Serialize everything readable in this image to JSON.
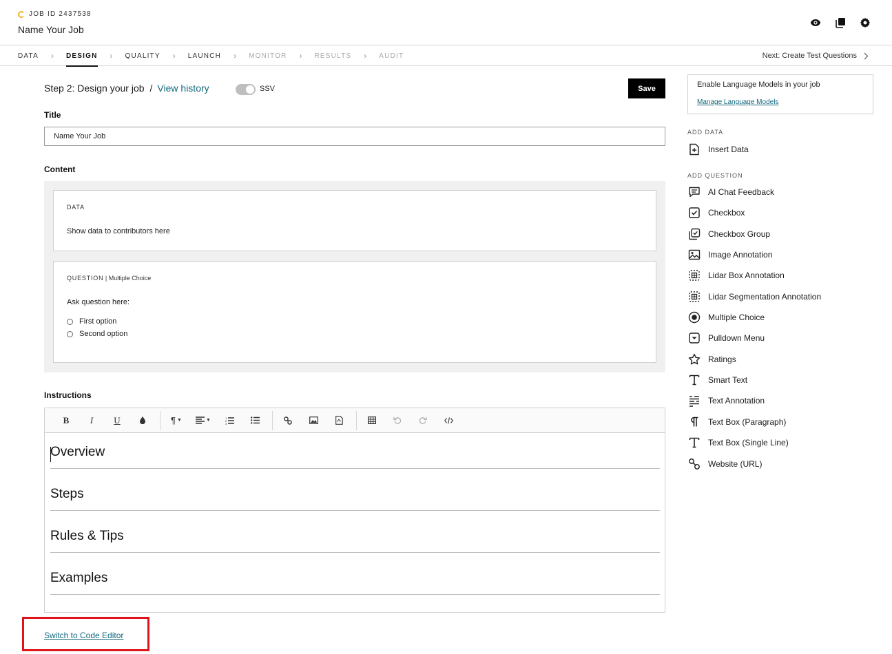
{
  "header": {
    "job_id": "JOB ID 2437538",
    "job_name": "Name Your Job"
  },
  "nav": {
    "steps": [
      {
        "label": "DATA",
        "state": "normal"
      },
      {
        "label": "DESIGN",
        "state": "active"
      },
      {
        "label": "QUALITY",
        "state": "normal"
      },
      {
        "label": "LAUNCH",
        "state": "normal"
      },
      {
        "label": "MONITOR",
        "state": "disabled"
      },
      {
        "label": "RESULTS",
        "state": "disabled"
      },
      {
        "label": "AUDIT",
        "state": "disabled"
      }
    ],
    "next_label": "Next: Create Test Questions"
  },
  "main": {
    "step_title": "Step 2: Design your job",
    "slash": "/",
    "view_history": "View history",
    "ssv_label": "SSV",
    "save_label": "Save",
    "title_label": "Title",
    "title_value": "Name Your Job",
    "content_label": "Content",
    "data_card": {
      "kicker": "DATA",
      "text": "Show data to contributors here"
    },
    "question_card": {
      "kicker": "QUESTION",
      "kicker_sub": " | Multiple Choice",
      "prompt": "Ask question here:",
      "options": [
        "First option",
        "Second option"
      ]
    },
    "instructions_label": "Instructions",
    "editor_headings": [
      "Overview",
      "Steps",
      "Rules & Tips",
      "Examples"
    ],
    "code_editor_link": "Switch to Code Editor"
  },
  "sidebar": {
    "lm_title": "Enable Language Models in your job",
    "lm_link": "Manage Language Models",
    "add_data_heading": "ADD DATA",
    "insert_data": "Insert Data",
    "add_question_heading": "ADD QUESTION",
    "questions": [
      {
        "label": "AI Chat Feedback",
        "icon": "chat-icon"
      },
      {
        "label": "Checkbox",
        "icon": "checkbox-icon"
      },
      {
        "label": "Checkbox Group",
        "icon": "checkbox-group-icon"
      },
      {
        "label": "Image Annotation",
        "icon": "image-icon"
      },
      {
        "label": "Lidar Box Annotation",
        "icon": "lidar-box-icon"
      },
      {
        "label": "Lidar Segmentation Annotation",
        "icon": "lidar-segmentation-icon"
      },
      {
        "label": "Multiple Choice",
        "icon": "radio-icon"
      },
      {
        "label": "Pulldown Menu",
        "icon": "pulldown-icon"
      },
      {
        "label": "Ratings",
        "icon": "star-icon"
      },
      {
        "label": "Smart Text",
        "icon": "text-t-icon"
      },
      {
        "label": "Text Annotation",
        "icon": "text-annotation-icon"
      },
      {
        "label": "Text Box (Paragraph)",
        "icon": "paragraph-icon"
      },
      {
        "label": "Text Box (Single Line)",
        "icon": "text-t-icon"
      },
      {
        "label": "Website (URL)",
        "icon": "link-icon"
      }
    ]
  },
  "colors": {
    "link": "#11677c",
    "highlight": "#e0121b",
    "save_bg": "#000000",
    "spinner": "#f0b42a"
  }
}
